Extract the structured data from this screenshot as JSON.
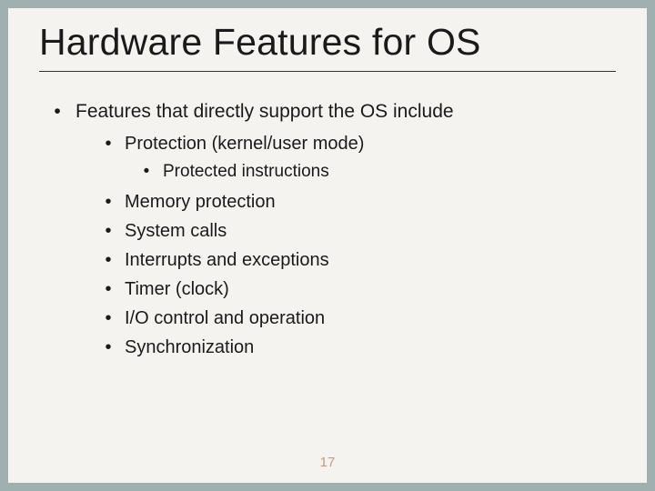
{
  "title": "Hardware Features for OS",
  "main": {
    "lead": "Features that directly support the OS include",
    "items": [
      "Protection (kernel/user mode)",
      "Memory protection",
      "System calls",
      "Interrupts and exceptions",
      "Timer (clock)",
      "I/O control and operation",
      "Synchronization"
    ],
    "subitem": "Protected instructions"
  },
  "bullet": "•",
  "page_number": "17"
}
